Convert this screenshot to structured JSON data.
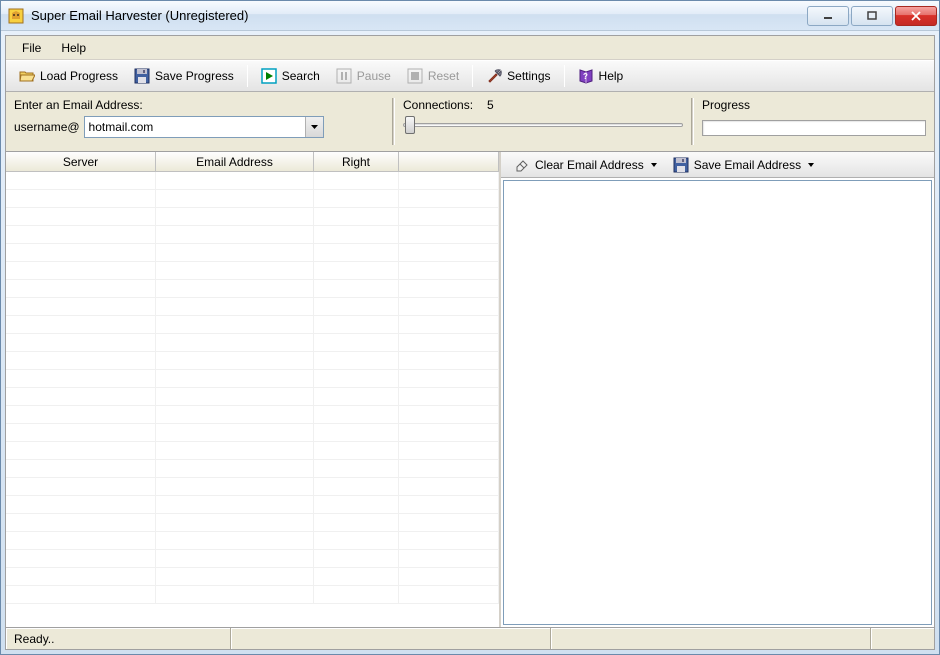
{
  "window": {
    "title": "Super Email Harvester (Unregistered)"
  },
  "menu": {
    "file": "File",
    "help": "Help"
  },
  "toolbar": {
    "load_progress": "Load Progress",
    "save_progress": "Save Progress",
    "search": "Search",
    "pause": "Pause",
    "reset": "Reset",
    "settings": "Settings",
    "help": "Help"
  },
  "config": {
    "email_label": "Enter an Email Address:",
    "username_suffix": "username@",
    "domain": "hotmail.com",
    "connections_label": "Connections:",
    "connections_value": "5",
    "progress_label": "Progress"
  },
  "table": {
    "columns": {
      "server": "Server",
      "email": "Email Address",
      "right": "Right"
    }
  },
  "right_panel": {
    "clear": "Clear Email Address",
    "save": "Save Email Address"
  },
  "status": {
    "text": "Ready.."
  }
}
